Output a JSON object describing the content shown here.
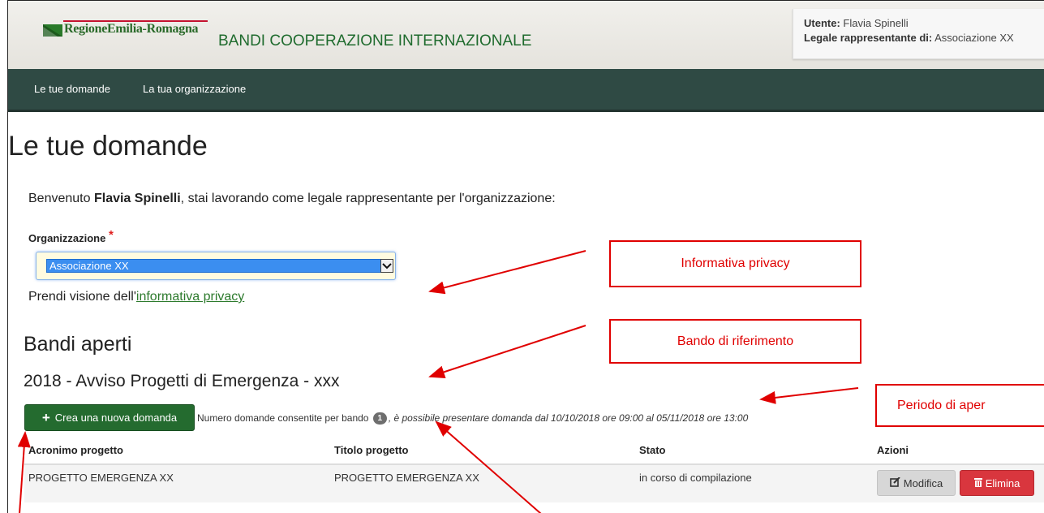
{
  "header": {
    "logo_text": "RegioneEmilia-Romagna",
    "app_title": "BANDI COOPERAZIONE INTERNAZIONALE",
    "user_label": "Utente:",
    "user_value": "Flavia Spinelli",
    "legal_label": "Legale rappresentante di:",
    "legal_value": "Associazione XX"
  },
  "nav": {
    "items": [
      {
        "label": "Le tue domande"
      },
      {
        "label": "La tua organizzazione"
      }
    ]
  },
  "page": {
    "title": "Le tue domande",
    "welcome_prefix": "Benvenuto",
    "welcome_name": "Flavia Spinelli",
    "welcome_suffix": ", stai lavorando come legale rappresentante per l'organizzazione:",
    "org_label": "Organizzazione",
    "org_required": "*",
    "org_selected": "Associazione XX",
    "privacy_prefix": "Prendi visione dell'",
    "privacy_link": "informativa privacy"
  },
  "bandi": {
    "section_title": "Bandi aperti",
    "bando_name": "2018 - Avviso Progetti di Emergenza - xxx",
    "new_button": "Crea una nuova domanda",
    "num_text": "Numero domande consentite per bando",
    "num_value": "1",
    "period_text": ", è possibile presentare domanda dal 10/10/2018 ore 09:00 al 05/11/2018 ore 13:00"
  },
  "table": {
    "columns": [
      "Acronimo progetto",
      "Titolo progetto",
      "Stato",
      "Azioni"
    ],
    "rows": [
      {
        "acronimo": "PROGETTO EMERGENZA XX",
        "titolo": "PROGETTO EMERGENZA XX",
        "stato": "in corso di compilazione"
      }
    ],
    "edit_button": "Modifica",
    "delete_button": "Elimina"
  },
  "callouts": {
    "privacy": "Informativa privacy",
    "bando": "Bando di riferimento",
    "periodo": "Periodo di aper"
  },
  "colors": {
    "navbar": "#2f4a44",
    "brand_green": "#246b2f",
    "danger": "#d9363e",
    "annotation_red": "#e00000"
  }
}
